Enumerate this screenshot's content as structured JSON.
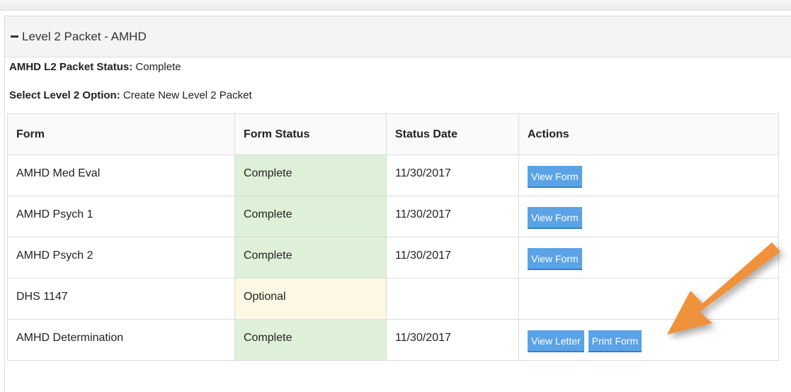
{
  "panel": {
    "title": "Level 2 Packet - AMHD"
  },
  "status": {
    "label": "AMHD L2 Packet Status:",
    "value": "Complete"
  },
  "option": {
    "label": "Select Level 2 Option:",
    "value": "Create New Level 2 Packet"
  },
  "table": {
    "headers": [
      "Form",
      "Form Status",
      "Status Date",
      "Actions"
    ],
    "rows": [
      {
        "form": "AMHD Med Eval",
        "status": "Complete",
        "date": "11/30/2017",
        "actions": [
          "View Form"
        ]
      },
      {
        "form": "AMHD Psych 1",
        "status": "Complete",
        "date": "11/30/2017",
        "actions": [
          "View Form"
        ]
      },
      {
        "form": "AMHD Psych 2",
        "status": "Complete",
        "date": "11/30/2017",
        "actions": [
          "View Form"
        ]
      },
      {
        "form": "DHS 1147",
        "status": "Optional",
        "date": "",
        "actions": []
      },
      {
        "form": "AMHD Determination",
        "status": "Complete",
        "date": "11/30/2017",
        "actions": [
          "View Letter",
          "Print Form"
        ]
      }
    ]
  },
  "colors": {
    "complete_bg": "#dff0d8",
    "optional_bg": "#fcf8e3",
    "button": "#5ba2e6",
    "arrow": "#f0913a"
  }
}
